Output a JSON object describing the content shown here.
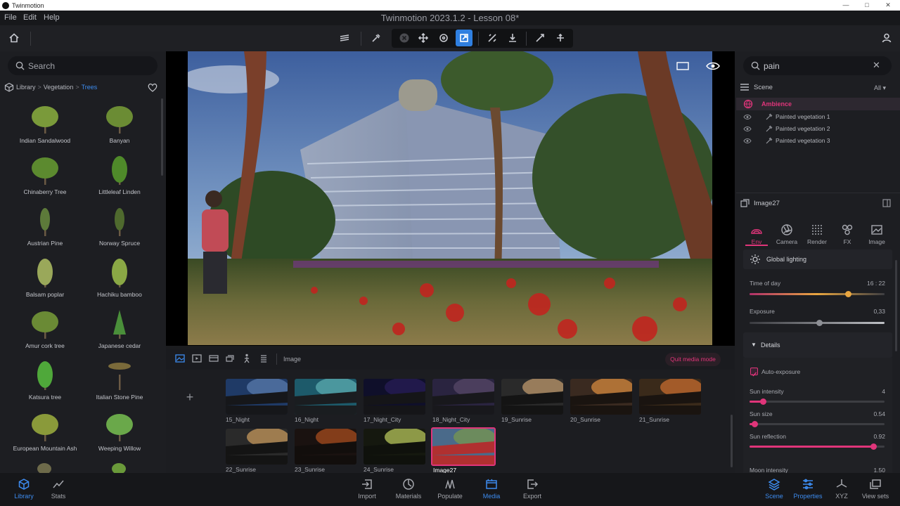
{
  "window": {
    "app_name": "Twinmotion",
    "doc_title": "Twinmotion 2023.1.2 - Lesson 08*"
  },
  "menu": [
    "File",
    "Edit",
    "Help"
  ],
  "library": {
    "search_placeholder": "Search",
    "breadcrumb": [
      "Library",
      "Vegetation",
      "Trees"
    ],
    "items": [
      "Indian Sandalwood",
      "Banyan",
      "Chinaberry Tree",
      "Littleleaf Linden",
      "Austrian Pine",
      "Norway Spruce",
      "Balsam poplar",
      "Hachiku bamboo",
      "Amur cork tree",
      "Japanese cedar",
      "Katsura tree",
      "Italian Stone Pine",
      "European Mountain Ash",
      "Weeping Willow"
    ]
  },
  "media": {
    "section_label": "Image",
    "quit_button": "Quit media mode",
    "add_symbol": "+",
    "thumbnails": [
      "15_Night",
      "16_Night",
      "17_Night_City",
      "18_Night_City",
      "19_Sunrise",
      "20_Sunrise",
      "21_Sunrise",
      "22_Sunrise",
      "23_Sunrise",
      "24_Sunrise",
      "Image27"
    ],
    "selected": "Image27"
  },
  "scene": {
    "search_value": "pain",
    "header": "Scene",
    "filter": "All",
    "group": "Ambience",
    "items": [
      "Painted vegetation 1",
      "Painted vegetation 2",
      "Painted vegetation 3"
    ]
  },
  "properties": {
    "object_name": "Image27",
    "tabs": [
      "Env",
      "Camera",
      "Render",
      "FX",
      "Image"
    ],
    "active_tab": "Env",
    "section": "Global lighting",
    "time_of_day": {
      "label": "Time of day",
      "value": "16 : 22",
      "fraction": 0.73
    },
    "exposure": {
      "label": "Exposure",
      "value": "0,33",
      "fraction": 0.52
    },
    "details_label": "Details",
    "auto_exposure": {
      "label": "Auto-exposure",
      "checked": true
    },
    "sun_intensity": {
      "label": "Sun intensity",
      "value": "4",
      "fraction": 0.1
    },
    "sun_size": {
      "label": "Sun size",
      "value": "0.54",
      "fraction": 0.04
    },
    "sun_reflection": {
      "label": "Sun reflection",
      "value": "0.92",
      "fraction": 0.92
    },
    "moon_intensity": {
      "label": "Moon intensity",
      "value": "1.50"
    }
  },
  "bottom_left": [
    "Library",
    "Stats"
  ],
  "bottom_center": [
    "Import",
    "Materials",
    "Populate",
    "Media",
    "Export"
  ],
  "bottom_right": [
    "Scene",
    "Properties",
    "XYZ",
    "View sets"
  ],
  "colors": {
    "accent_pink": "#e0357a",
    "accent_blue": "#3d8cf0",
    "time_gradient_start": "#b0306a",
    "time_gradient_end": "#e8a640"
  }
}
